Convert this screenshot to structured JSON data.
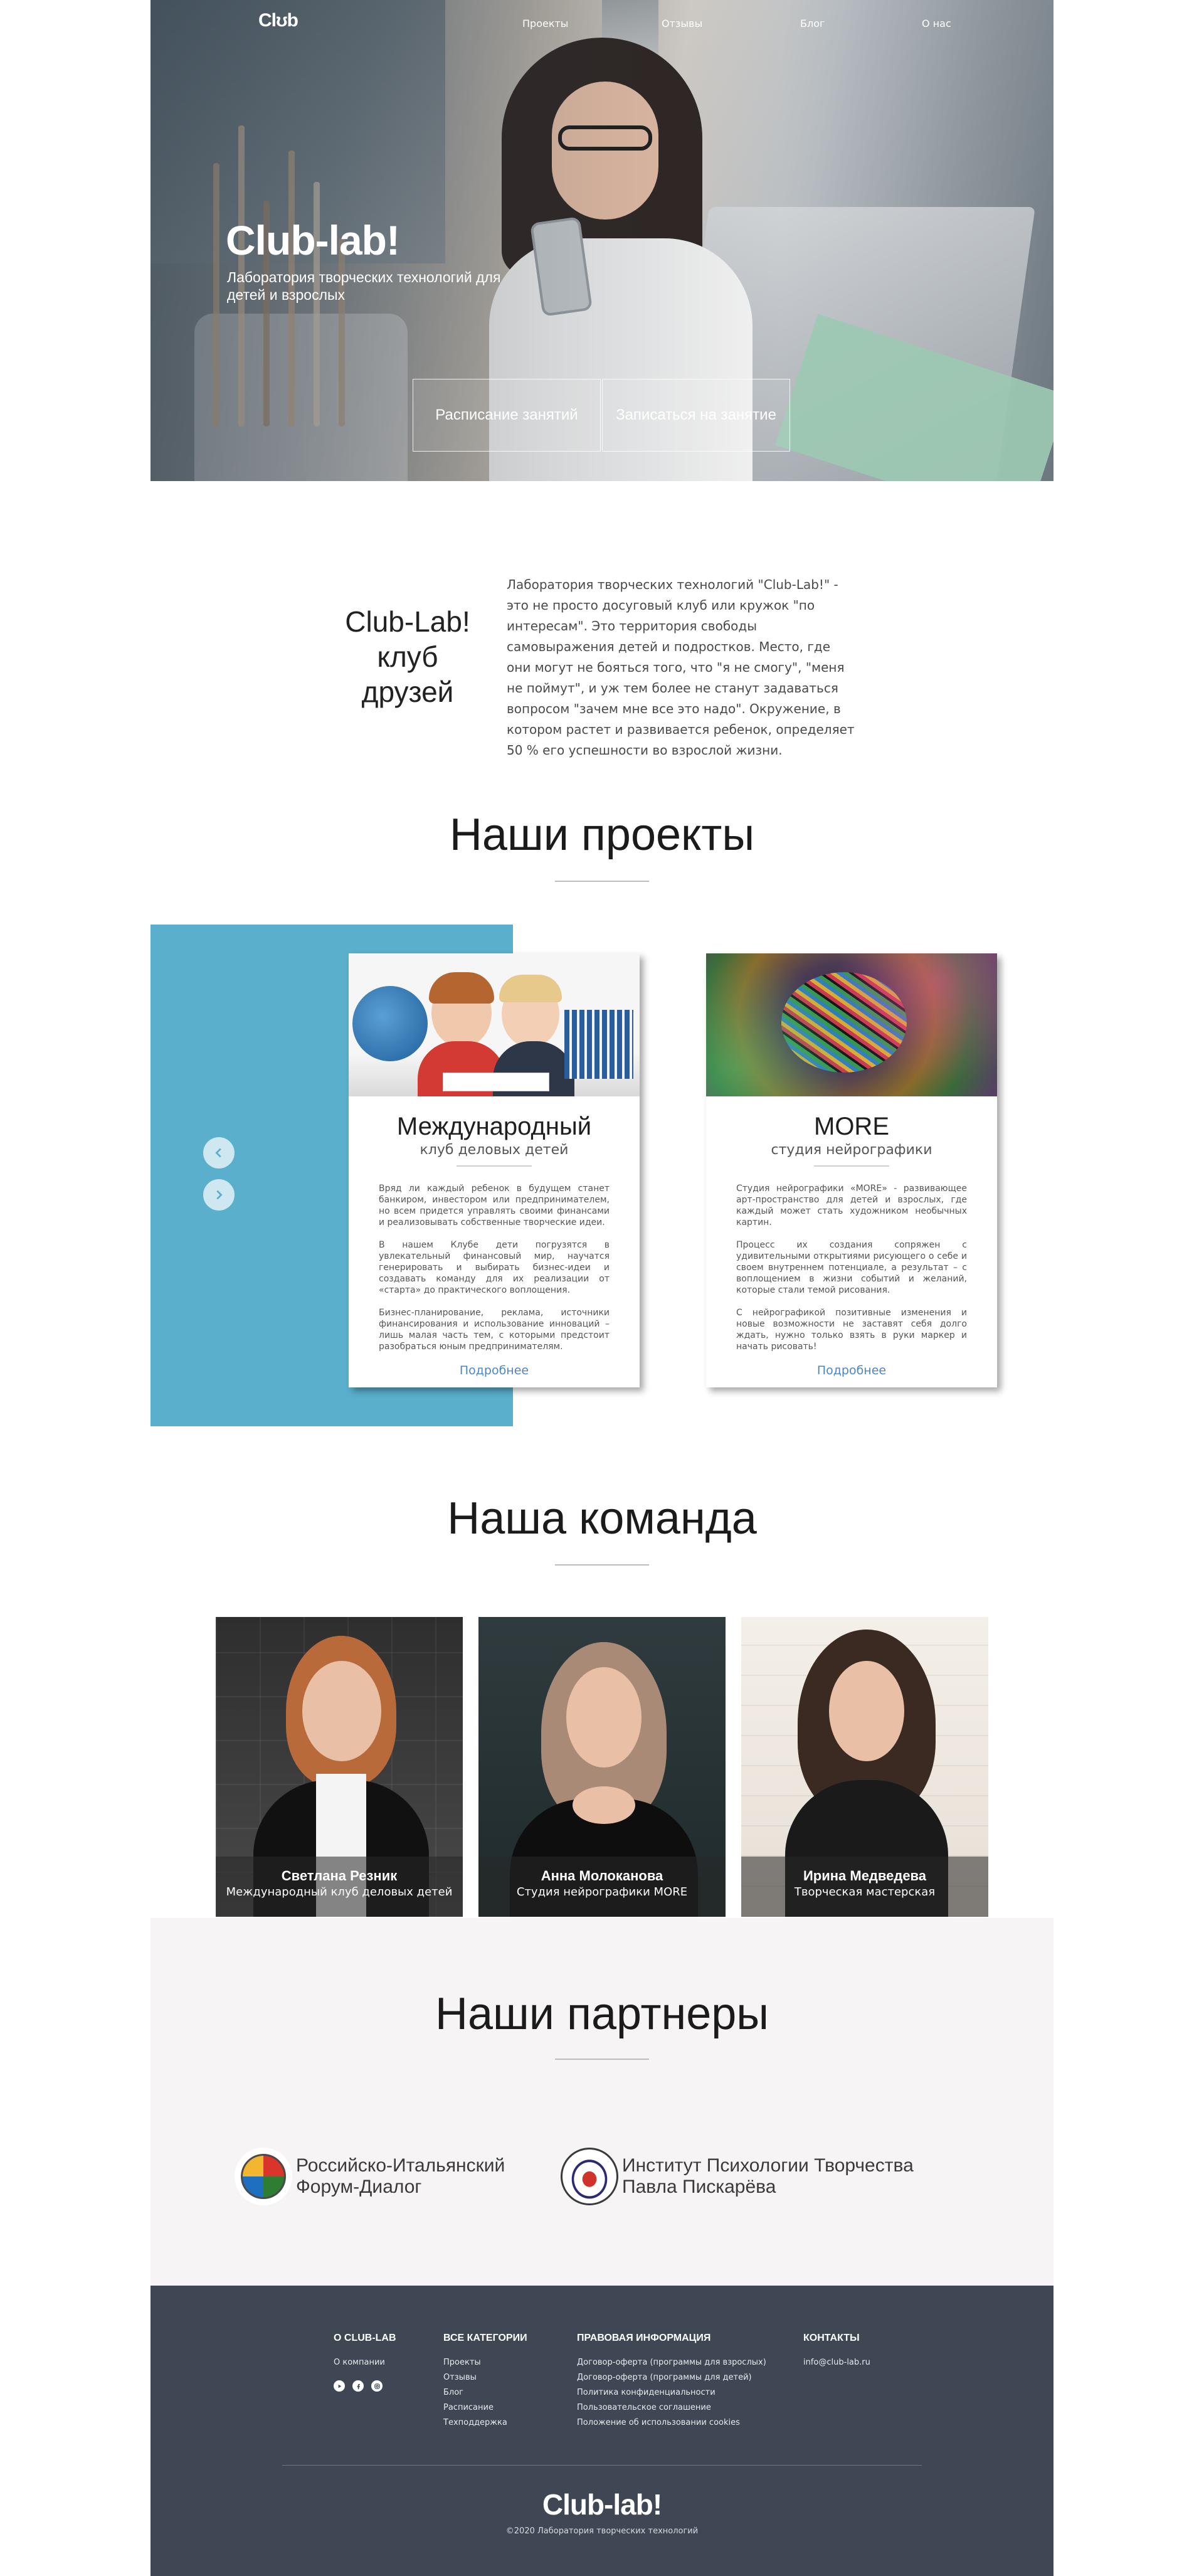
{
  "brand": {
    "logo_small": "Clʊb",
    "logo_full": "Club-lab!"
  },
  "nav": {
    "items": [
      {
        "label": "Проекты"
      },
      {
        "label": "Отзывы"
      },
      {
        "label": "Блог"
      },
      {
        "label": "О нас"
      }
    ]
  },
  "hero": {
    "title": "Club-lab!",
    "subtitle": "Лаборатория творческих технологий для детей и взрослых",
    "btn_schedule": "Расписание занятий",
    "btn_signup": "Записаться на занятие"
  },
  "about": {
    "title": "Club-Lab! клуб друзей",
    "text": "Лаборатория творческих технологий \"Club-Lab!\" - это не просто досуговый клуб или кружок \"по интересам\". Это территория свободы самовыражения детей и подростков. Место, где они могут не бояться того, что \"я не смогу\", \"меня не поймут\", и уж тем более не станут задаваться вопросом \"зачем мне все это надо\". Окружение, в котором растет и развивается ребенок, определяет 50 % его успешности во взрослой жизни."
  },
  "projects": {
    "heading": "Наши проекты",
    "cards": [
      {
        "title": "Международный",
        "subtitle": "клуб деловых детей",
        "paragraphs": [
          "Вряд ли каждый ребенок в будущем станет банкиром, инвестором или предпринимателем, но всем придется управлять своими финансами и реализовывать собственные творческие идеи.",
          "В нашем Клубе дети погрузятся в увлекательный финансовый мир, научатся генерировать и выбирать бизнес-идеи и создавать команду для их реализации от «старта» до практического воплощения.",
          "Бизнес-планирование, реклама, источники финансирования и использование инноваций – лишь малая часть тем, с которыми предстоит разобраться юным предпринимателям."
        ],
        "more": "Подробнее"
      },
      {
        "title": "MORE",
        "subtitle": "студия нейрографики",
        "paragraphs": [
          "Студия нейрографики «MORE» - развивающее арт-пространство для детей и взрослых, где каждый может стать художником необычных картин.",
          "Процесс их создания сопряжен с удивительными открытиями рисующего о себе и своем внутреннем потенциале, а результат – с воплощением в жизни событий и желаний, которые стали темой рисования.",
          "С нейрографикой позитивные изменения и новые возможности не заставят себя долго ждать, нужно только взять в руки маркер и начать рисовать!"
        ],
        "more": "Подробнее"
      }
    ]
  },
  "team": {
    "heading": "Наша команда",
    "members": [
      {
        "name": "Светлана Резник",
        "role": "Международный клуб деловых детей"
      },
      {
        "name": "Анна Молоканова",
        "role": "Студия нейрографики MORE"
      },
      {
        "name": "Ирина Медведева",
        "role": "Творческая мастерская"
      }
    ]
  },
  "partners": {
    "heading": "Наши партнеры",
    "items": [
      {
        "name": "Российско-Итальянский Форум-Диалог"
      },
      {
        "name": "Институт Психологии Творчества Павла Пискарёва"
      }
    ]
  },
  "footer": {
    "col_about": {
      "heading": "О CLUB-LAB",
      "links": [
        "О компании"
      ]
    },
    "col_categories": {
      "heading": "ВСЕ КАТЕГОРИИ",
      "links": [
        "Проекты",
        "Отзывы",
        "Блог",
        "Расписание",
        "Техподдержка"
      ]
    },
    "col_legal": {
      "heading": "ПРАВОВАЯ ИНФОРМАЦИЯ",
      "links": [
        "Договор-оферта (программы для взрослых)",
        "Договор-оферта (программы для детей)",
        "Политика конфиденциальности",
        "Пользовательское соглашение",
        "Положение об использовании cookies"
      ]
    },
    "col_contacts": {
      "heading": "КОНТАКТЫ",
      "links": [
        "info@club-lab.ru"
      ]
    },
    "social_icons": [
      "youtube-icon",
      "facebook-icon",
      "instagram-icon"
    ],
    "logo": "Club-lab!",
    "copyright": "©2020 Лаборатория творческих технологий"
  },
  "colors": {
    "accent_blue": "#5aafcc",
    "footer_bg": "#3e4753",
    "link": "#4a86c8",
    "partners_bg": "#f6f4f4"
  }
}
